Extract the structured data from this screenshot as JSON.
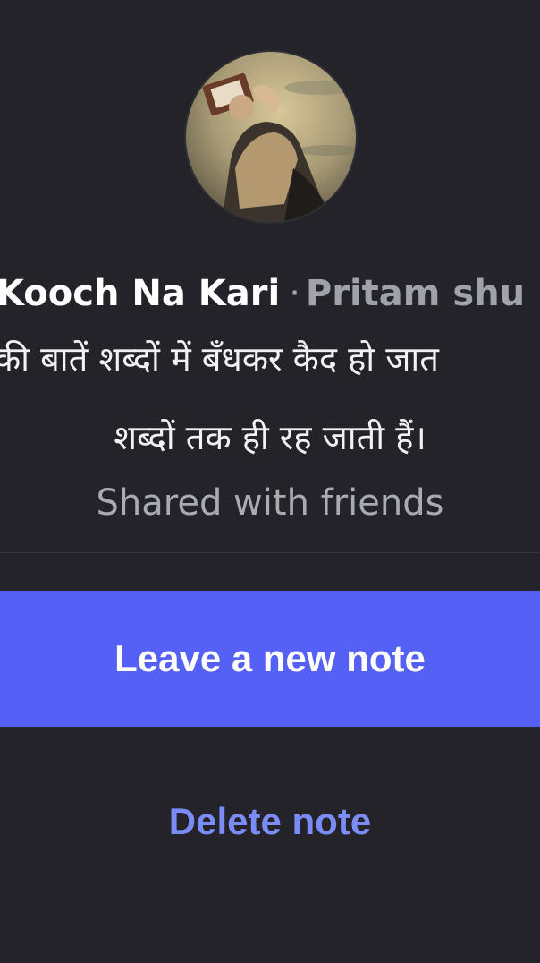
{
  "note": {
    "title": "Kooch Na Kari",
    "separator": "·",
    "author": "Pritam shu",
    "text_line1": "की बातें शब्दों में बँधकर  कैद हो जात",
    "text_line2": "शब्दों तक ही रह जाती हैं।",
    "audience": "Shared with friends"
  },
  "actions": {
    "primary_label": "Leave a new note",
    "delete_label": "Delete note"
  },
  "colors": {
    "background": "#232329",
    "primary_button": "#5560f5",
    "delete_link": "#7b8cf6",
    "muted_text": "#a9abb3"
  }
}
